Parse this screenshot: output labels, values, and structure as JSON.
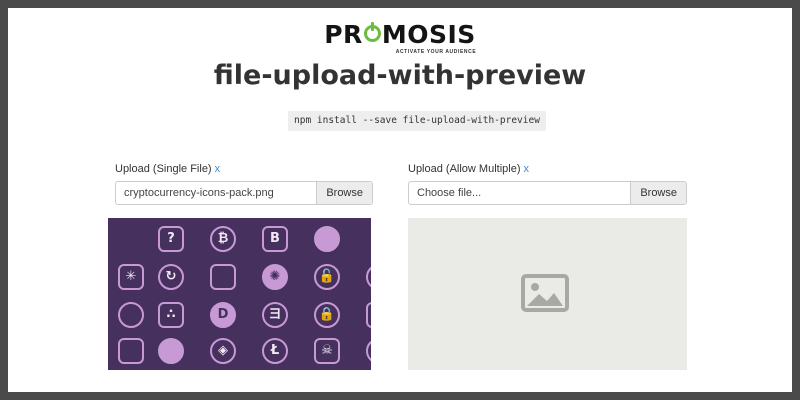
{
  "logo": {
    "text_left": "PR",
    "text_right": "MOSIS",
    "tagline": "ACTIVATE YOUR AUDIENCE"
  },
  "title": "file-upload-with-preview",
  "install_command": "npm install --save file-upload-with-preview",
  "single": {
    "label": "Upload (Single File)",
    "clear": "x",
    "value": "cryptocurrency-icons-pack.png",
    "browse": "Browse"
  },
  "multiple": {
    "label": "Upload (Allow Multiple)",
    "clear": "x",
    "placeholder": "Choose file...",
    "browse": "Browse"
  },
  "colors": {
    "logo_accent": "#6cbd3f",
    "link": "#3f88d4",
    "preview_bg": "#46305e",
    "icon_stroke": "#c79ad6",
    "empty_bg": "#eaeae6"
  },
  "preview_icons": [
    {
      "name": "question-coin-icon",
      "glyph": "?"
    },
    {
      "name": "bitcoin-icon",
      "glyph": "₿"
    },
    {
      "name": "bitcoin-outline-icon",
      "glyph": "B"
    },
    {
      "name": "chain-link-icon",
      "glyph": ""
    },
    {
      "name": "network-burst-icon",
      "glyph": "✳"
    },
    {
      "name": "refresh-coin-icon",
      "glyph": "↻"
    },
    {
      "name": "rainbow-dots-icon",
      "glyph": ""
    },
    {
      "name": "hub-nodes-icon",
      "glyph": "✺"
    },
    {
      "name": "unlock-icon",
      "glyph": "🔓"
    },
    {
      "name": "magnifier-icon",
      "glyph": "⚲"
    },
    {
      "name": "face-icon",
      "glyph": ""
    },
    {
      "name": "triangle-dots-icon",
      "glyph": "∴"
    },
    {
      "name": "dogecoin-icon",
      "glyph": "D"
    },
    {
      "name": "cube-hex-icon",
      "glyph": "ヨ"
    },
    {
      "name": "lock-icon",
      "glyph": "🔒"
    },
    {
      "name": "diamond-icon",
      "glyph": ""
    },
    {
      "name": "feather-icon",
      "glyph": ""
    },
    {
      "name": "mask-face-icon",
      "glyph": ""
    },
    {
      "name": "cube-icon",
      "glyph": "◈"
    },
    {
      "name": "litecoin-icon",
      "glyph": "Ł"
    },
    {
      "name": "skull-icon",
      "glyph": "☠"
    },
    {
      "name": "hexagon-icon",
      "glyph": ""
    }
  ]
}
